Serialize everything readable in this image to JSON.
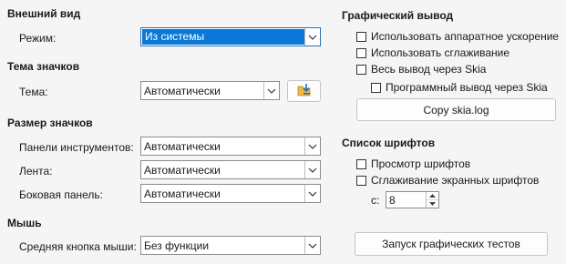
{
  "appearance": {
    "title": "Внешний вид",
    "mode_label": "Режим:",
    "mode_value": "Из системы"
  },
  "icon_theme": {
    "title": "Тема значков",
    "theme_label": "Тема:",
    "theme_value": "Автоматически"
  },
  "icon_size": {
    "title": "Размер значков",
    "toolbars_label": "Панели инструментов:",
    "toolbars_value": "Автоматически",
    "ribbon_label": "Лента:",
    "ribbon_value": "Автоматически",
    "sidebar_label": "Боковая панель:",
    "sidebar_value": "Автоматически"
  },
  "mouse": {
    "title": "Мышь",
    "middle_label": "Средняя кнопка мыши:",
    "middle_value": "Без функции"
  },
  "graphics": {
    "title": "Графический вывод",
    "hw_accel": "Использовать аппаратное ускорение",
    "antialias": "Использовать сглаживание",
    "skia_all": "Весь вывод через Skia",
    "skia_sw": "Программный вывод через Skia",
    "copy_log_button": "Copy skia.log"
  },
  "font_list": {
    "title": "Список шрифтов",
    "preview": "Просмотр шрифтов",
    "screen_antialias": "Сглаживание экранных шрифтов",
    "from_label": "с:",
    "from_value": "8"
  },
  "run_tests_button": "Запуск графических тестов",
  "icons": {
    "dropdown": "chevron-down-icon",
    "add_theme": "add-icon-theme-icon",
    "spin_up": "caret-up-icon",
    "spin_down": "caret-down-icon"
  }
}
